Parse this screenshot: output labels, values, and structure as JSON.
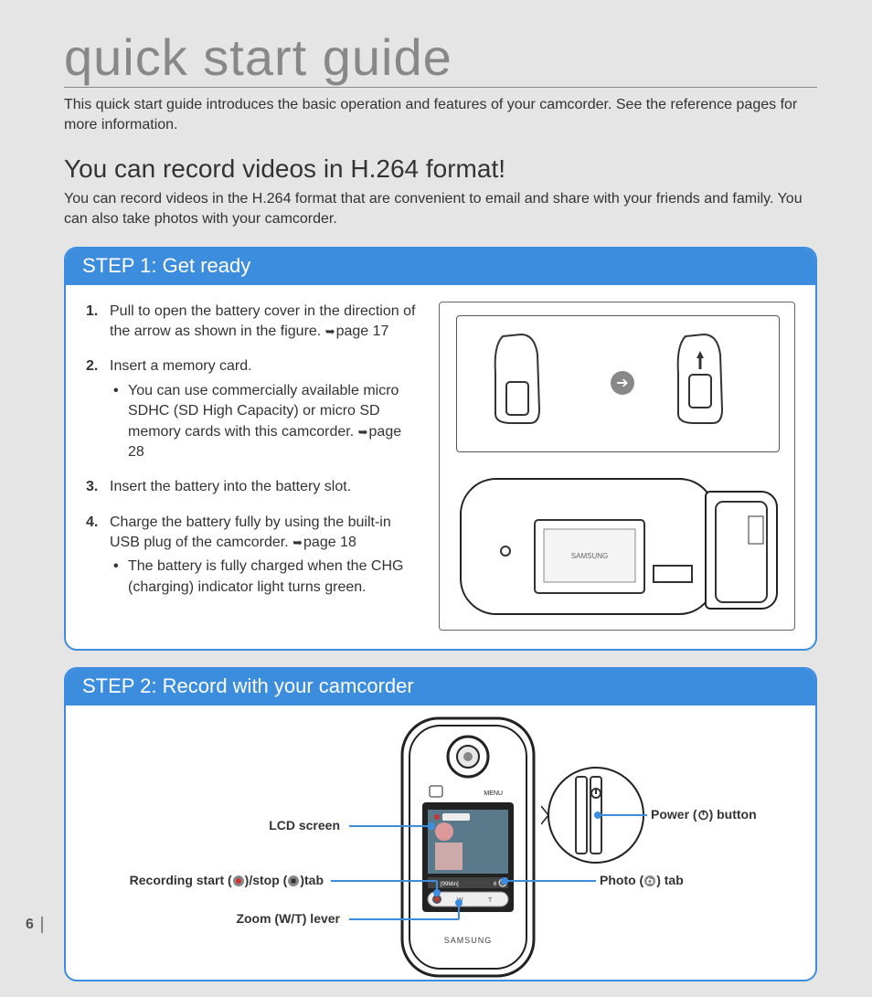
{
  "page_number": "6",
  "title": "quick start guide",
  "intro": "This quick start guide introduces the basic operation and features of your camcorder. See the reference pages for more information.",
  "subtitle": "You can record videos in H.264 format!",
  "sub_desc": "You can record videos in the H.264 format that are convenient to email and share with your friends and family. You can also take photos with your camcorder.",
  "step1": {
    "header": "STEP 1: Get ready",
    "items": [
      {
        "text": "Pull to open the battery cover in the direction of the arrow as shown in the figure. ",
        "ref": "page 17"
      },
      {
        "text": "Insert a memory card.",
        "bullets": [
          {
            "text": "You can use commercially available micro SDHC (SD High Capacity) or micro SD memory cards with this camcorder. ",
            "ref": "page 28"
          }
        ]
      },
      {
        "text": "Insert the battery into the battery slot."
      },
      {
        "text": "Charge the battery fully by using the built-in USB plug of the camcorder. ",
        "ref": "page 18",
        "bullets": [
          {
            "text": "The battery is fully charged when the CHG (charging) indicator light turns green."
          }
        ]
      }
    ]
  },
  "step2": {
    "header": "STEP 2: Record with your camcorder",
    "labels": {
      "lcd": "LCD screen",
      "rec_prefix": "Recording start (",
      "rec_mid": ")/stop (",
      "rec_suffix": ")tab",
      "zoom": "Zoom (W/T) lever",
      "power_prefix": "Power (",
      "power_suffix": ") button",
      "photo_prefix": "Photo (",
      "photo_suffix": ") tab"
    }
  }
}
